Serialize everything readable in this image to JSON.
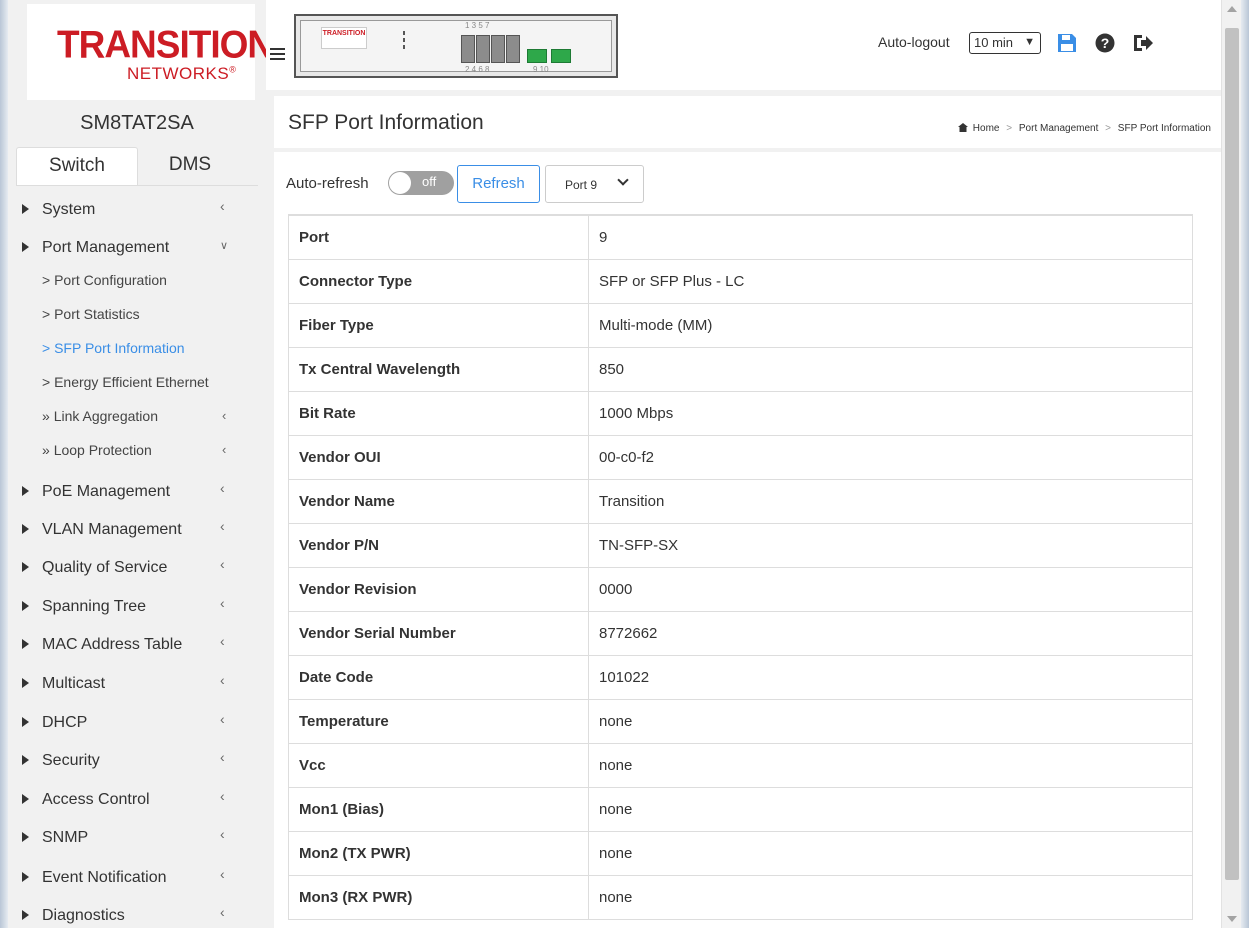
{
  "brand": {
    "logo_main": "TRANSITION",
    "logo_sub": "NETWORKS",
    "panel_logo": "TRANSITION"
  },
  "device": {
    "name": "SM8TAT2SA"
  },
  "tabs": [
    {
      "label": "Switch"
    },
    {
      "label": "DMS"
    }
  ],
  "nav": {
    "system": "System",
    "port_management": "Port Management",
    "port_configuration": "Port Configuration",
    "port_statistics": "Port Statistics",
    "sfp_port_information": "SFP Port Information",
    "energy_efficient_ethernet": "Energy Efficient Ethernet",
    "link_aggregation": "Link Aggregation",
    "loop_protection": "Loop Protection",
    "poe_management": "PoE Management",
    "vlan_management": "VLAN Management",
    "quality_of_service": "Quality of Service",
    "spanning_tree": "Spanning Tree",
    "mac_address_table": "MAC Address Table",
    "multicast": "Multicast",
    "dhcp": "DHCP",
    "security": "Security",
    "access_control": "Access Control",
    "snmp": "SNMP",
    "event_notification": "Event Notification",
    "diagnostics": "Diagnostics"
  },
  "panel": {
    "top_numbers": "1  3  5  7",
    "bottom_numbers": "2  4  6  8",
    "sfp_numbers": "9  10"
  },
  "header": {
    "autologout_label": "Auto-logout",
    "autologout_value": "10 min",
    "icons": [
      "save-icon",
      "help-icon",
      "logout-icon"
    ]
  },
  "page": {
    "title": "SFP Port Information",
    "breadcrumb": {
      "home": "Home",
      "section": "Port Management",
      "current": "SFP Port Information"
    }
  },
  "controls": {
    "auto_refresh_label": "Auto-refresh",
    "toggle_state": "off",
    "refresh_label": "Refresh",
    "port_select_value": "Port 9"
  },
  "table": {
    "rows": [
      {
        "key": "Port",
        "value": "9"
      },
      {
        "key": "Connector Type",
        "value": "SFP or SFP Plus - LC"
      },
      {
        "key": "Fiber Type",
        "value": "Multi-mode (MM)"
      },
      {
        "key": "Tx Central Wavelength",
        "value": "850"
      },
      {
        "key": "Bit Rate",
        "value": "1000 Mbps"
      },
      {
        "key": "Vendor OUI",
        "value": "00-c0-f2"
      },
      {
        "key": "Vendor Name",
        "value": "Transition"
      },
      {
        "key": "Vendor P/N",
        "value": "TN-SFP-SX"
      },
      {
        "key": "Vendor Revision",
        "value": "0000"
      },
      {
        "key": "Vendor Serial Number",
        "value": "8772662"
      },
      {
        "key": "Date Code",
        "value": "101022"
      },
      {
        "key": "Temperature",
        "value": "none"
      },
      {
        "key": "Vcc",
        "value": "none"
      },
      {
        "key": "Mon1 (Bias)",
        "value": "none"
      },
      {
        "key": "Mon2 (TX PWR)",
        "value": "none"
      },
      {
        "key": "Mon3 (RX PWR)",
        "value": "none"
      }
    ]
  },
  "colors": {
    "accent": "#3a8ee6",
    "brand_red": "#cc1c24",
    "save_icon": "#3a8ee6",
    "sfp_led": "#2ea84a"
  }
}
